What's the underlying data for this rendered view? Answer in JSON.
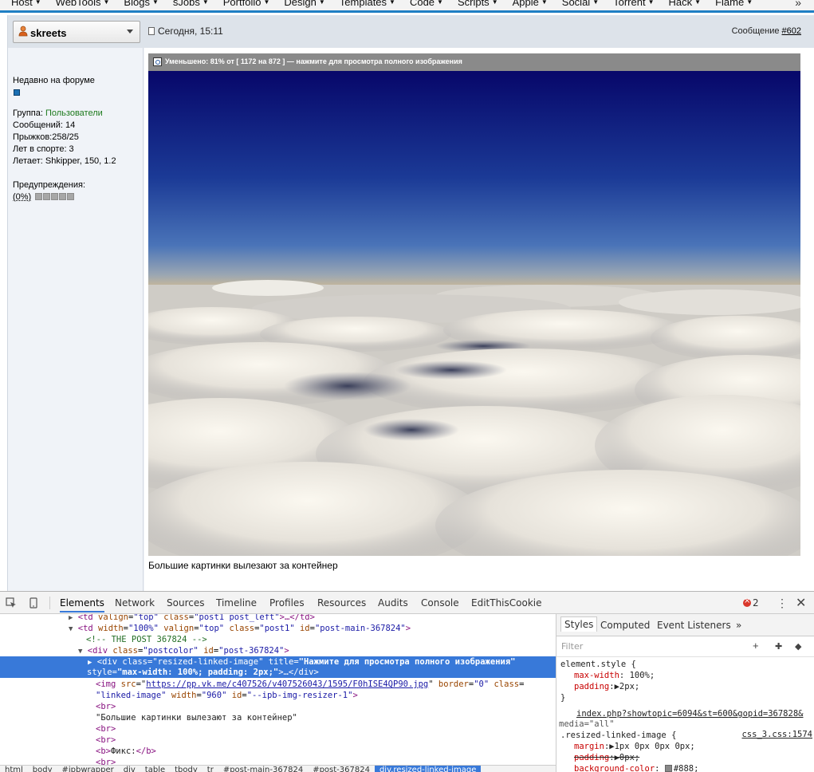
{
  "topnav": {
    "items": [
      "Host",
      "WebTools",
      "Blogs",
      "sJobs",
      "Portfolio",
      "Design",
      "Templates",
      "Code",
      "Scripts",
      "Apple",
      "Social",
      "Torrent",
      "Hack",
      "Flame"
    ],
    "more": "»"
  },
  "post": {
    "username": "skreets",
    "date": "Сегодня, 15:11",
    "number_label": "Сообщение ",
    "number": "#602",
    "user_info": {
      "recently": "Недавно на форуме",
      "group_label": "Группа: ",
      "group_value": "Пользователи",
      "messages": "Сообщений: 14",
      "jumps": "Прыжков:258/25",
      "years": "Лет в спорте: 3",
      "flies": "Летает: Shkipper, 150, 1.2",
      "warnings_label": "Предупреждения:",
      "warnings_value": "(0%)",
      "warning_level": 0
    },
    "image_bar": "Уменьшено: 81% от [ 1172 на 872 ] — нажмите для просмотра полного изображения",
    "text": "Большие картинки вылезают за контейнер"
  },
  "devtools": {
    "tabs": [
      "Elements",
      "Network",
      "Sources",
      "Timeline",
      "Profiles",
      "Resources",
      "Audits",
      "Console",
      "EditThisCookie"
    ],
    "active_tab": "Elements",
    "error_count": "2",
    "dom_lines": {
      "l1_tag": "<td",
      "l1_a1": "valign",
      "l1_v1": "\"top\"",
      "l1_a2": "class",
      "l1_v2": "\"post1 post_left\"",
      "l1_end": ">…</td>",
      "l2_tag": "<td",
      "l2_a1": "width",
      "l2_v1": "\"100%\"",
      "l2_a2": "valign",
      "l2_v2": "\"top\"",
      "l2_a3": "class",
      "l2_v3": "\"post1\"",
      "l2_a4": "id",
      "l2_v4": "\"post-main-367824\"",
      "l2_end": ">",
      "l3_comment": "<!-- THE POST 367824 -->",
      "l4_tag": "<div",
      "l4_a1": "class",
      "l4_v1": "\"postcolor\"",
      "l4_a2": "id",
      "l4_v2": "\"post-367824\"",
      "l4_end": ">",
      "l5_tag": "<div",
      "l5_a1": "class",
      "l5_v1": "\"resized-linked-image\"",
      "l5_a2": "title",
      "l5_v2": "\"Нажмите для просмотра полного изображения\"",
      "l6_a1": "style",
      "l6_v1": "\"max-width: 100%; padding: 2px;\"",
      "l6_end": ">…</div>",
      "l7_tag": "<img",
      "l7_a1": "src",
      "l7_v1": "https://pp.vk.me/c407526/v407526043/1595/F0hISE4QP90.jpg",
      "l7_a2": "border",
      "l7_v2": "\"0\"",
      "l7_a3": "class",
      "l8_v3": "\"linked-image\"",
      "l8_a4": "width",
      "l8_v4": "\"960\"",
      "l8_a5": "id",
      "l8_v5": "\"--ipb-img-resizer-1\"",
      "l8_end": ">",
      "br": "<br>",
      "l10_text": "\"Большие картинки вылезают за контейнер\"",
      "l13_b_open": "<b>",
      "l13_text": "Фикс:",
      "l13_b_close": "</b>"
    },
    "breadcrumbs": [
      "html",
      "body",
      "#ipbwrapper",
      "div",
      "table",
      "tbody",
      "tr",
      "#post-main-367824",
      "#post-367824",
      "div.resized-linked-image"
    ],
    "styles": {
      "tabs": [
        "Styles",
        "Computed",
        "Event Listeners"
      ],
      "more": "»",
      "filter_placeholder": "Filter",
      "element_style": "element.style {",
      "prop1": "max-width",
      "val1": "100%;",
      "prop2": "padding",
      "val2": "2px;",
      "close": "}",
      "source_link": "index.php?showtopic=6094&st=600&gopid=367828&",
      "media": "media=\"all\"",
      "rule_selector": ".resized-linked-image {",
      "rule_src": "css_3.css:1574",
      "prop3": "margin",
      "val3": "1px 0px 0px 0px;",
      "prop4": "padding",
      "val4": "0px;",
      "prop5": "background-color",
      "val5": "#888;",
      "swatch_color": "#888888"
    }
  }
}
